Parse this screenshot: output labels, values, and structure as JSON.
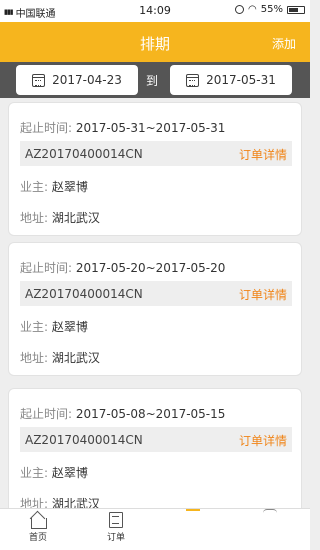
{
  "status": {
    "carrier": "中国联通",
    "time": "14:09",
    "battery": "55%",
    "battery_level": 0.55
  },
  "header": {
    "title": "排期",
    "add_label": "添加"
  },
  "filter": {
    "start_date": "2017-04-23",
    "to_label": "到",
    "end_date": "2017-05-31"
  },
  "labels": {
    "time": "起止时间:",
    "owner": "业主:",
    "address": "地址:",
    "order_link": "订单详情"
  },
  "cards": [
    {
      "time_range": "2017-05-31~2017-05-31",
      "order_no": "AZ20170400014CN",
      "owner": "赵翠博",
      "address": "湖北武汉"
    },
    {
      "time_range": "2017-05-20~2017-05-20",
      "order_no": "AZ20170400014CN",
      "owner": "赵翠博",
      "address": "湖北武汉"
    },
    {
      "time_range": "2017-05-08~2017-05-15",
      "order_no": "AZ20170400014CN",
      "owner": "赵翠博",
      "address": "湖北武汉"
    }
  ],
  "nav": {
    "home": "首页",
    "orders": "订单"
  },
  "colors": {
    "accent": "#f6b51e",
    "link": "#f08519",
    "filter_bg": "#555555"
  }
}
